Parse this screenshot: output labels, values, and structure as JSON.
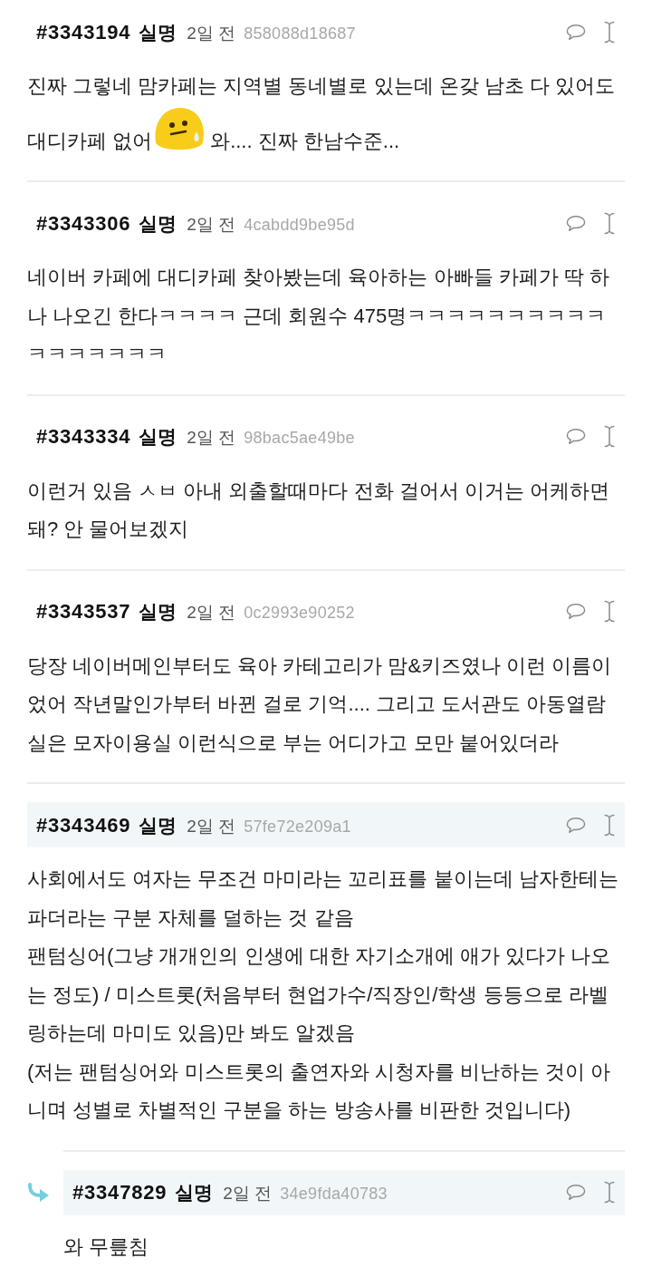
{
  "comments": [
    {
      "number": "#3343194",
      "author": "실명",
      "time": "2일 전",
      "hash": "858088d18687",
      "highlighted": false,
      "paragraphs": [
        [
          {
            "kind": "text",
            "text": "진짜 그렇네 맘카페는 지역별 동네별로 있는데 온갖 남초 다 있어도 대디카페 없어"
          },
          {
            "kind": "emoji"
          },
          {
            "kind": "text",
            "text": "와.... 진짜 한남수준..."
          }
        ]
      ]
    },
    {
      "number": "#3343306",
      "author": "실명",
      "time": "2일 전",
      "hash": "4cabdd9be95d",
      "highlighted": false,
      "paragraphs": [
        [
          {
            "kind": "text",
            "text": "네이버 카페에 대디카페 찾아봤는데 육아하는 아빠들 카페가 딱 하나 나오긴 한다ㅋㅋㅋㅋ 근데 회원수 475명ㅋㅋㅋㅋㅋㅋㅋㅋㅋㅋㅋㅋㅋㅋㅋㅋㅋ"
          }
        ]
      ]
    },
    {
      "number": "#3343334",
      "author": "실명",
      "time": "2일 전",
      "hash": "98bac5ae49be",
      "highlighted": false,
      "paragraphs": [
        [
          {
            "kind": "text",
            "text": "이런거 있음 ㅅㅂ 아내 외출할때마다 전화 걸어서 이거는 어케하면 돼? 안 물어보겠지"
          }
        ]
      ]
    },
    {
      "number": "#3343537",
      "author": "실명",
      "time": "2일 전",
      "hash": "0c2993e90252",
      "highlighted": false,
      "paragraphs": [
        [
          {
            "kind": "text",
            "text": "당장 네이버메인부터도 육아 카테고리가 맘&키즈였나 이런 이름이었어 작년말인가부터 바뀐 걸로 기억.... 그리고 도서관도 아동열람실은 모자이용실 이런식으로 부는 어디가고 모만 붙어있더라"
          }
        ]
      ]
    },
    {
      "number": "#3343469",
      "author": "실명",
      "time": "2일 전",
      "hash": "57fe72e209a1",
      "highlighted": true,
      "paragraphs": [
        [
          {
            "kind": "text",
            "text": "사회에서도 여자는 무조건 마미라는 꼬리표를 붙이는데 남자한테는 파더라는 구분 자체를 덜하는 것 같음"
          }
        ],
        [
          {
            "kind": "text",
            "text": "팬텀싱어(그냥 개개인의 인생에 대한 자기소개에 애가 있다가 나오는 정도) / 미스트롯(처음부터 현업가수/직장인/학생 등등으로 라벨링하는데 마미도 있음)만 봐도 알겠음"
          }
        ],
        [
          {
            "kind": "text",
            "text": "(저는 팬텀싱어와 미스트롯의 출연자와 시청자를 비난하는 것이 아니며 성별로 차별적인 구분을 하는 방송사를 비판한 것입니다)"
          }
        ]
      ],
      "children": [
        {
          "number": "#3347829",
          "author": "실명",
          "time": "2일 전",
          "hash": "34e9fda40783",
          "highlighted": true,
          "paragraphs": [
            [
              {
                "kind": "text",
                "text": "와 무릎침"
              }
            ]
          ]
        }
      ]
    }
  ]
}
